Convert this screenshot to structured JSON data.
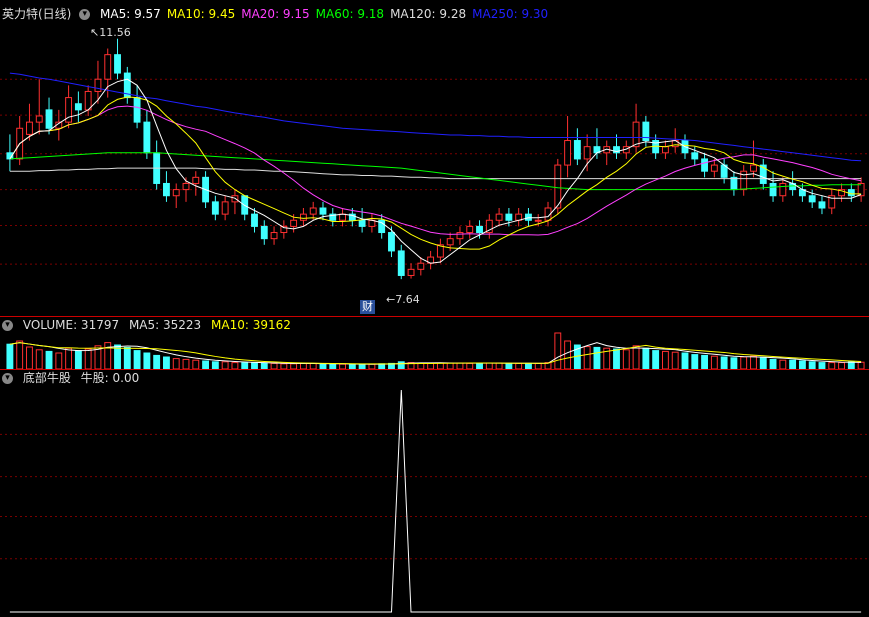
{
  "main": {
    "title": "英力特(日线)",
    "ma": [
      {
        "label": "MA5",
        "value": "9.57",
        "color": "#ffffff"
      },
      {
        "label": "MA10",
        "value": "9.45",
        "color": "#ffff00"
      },
      {
        "label": "MA20",
        "value": "9.15",
        "color": "#ff40ff"
      },
      {
        "label": "MA60",
        "value": "9.18",
        "color": "#00ff00"
      },
      {
        "label": "MA120",
        "value": "9.28",
        "color": "#dddddd"
      },
      {
        "label": "MA250",
        "value": "9.30",
        "color": "#2020ff"
      }
    ],
    "high_label": "11.56",
    "low_label": "7.64",
    "cai_badge": "财"
  },
  "volume": {
    "label": "VOLUME: 31797",
    "ma5": "MA5: 35223",
    "ma10": "MA10: 39162"
  },
  "indicator": {
    "title": "底部牛股",
    "line_label": "牛股: 0.00"
  },
  "colors": {
    "up": "#ff3030",
    "down": "#40ffff",
    "grid": "#7a0000",
    "border": "#c00000"
  },
  "chart_data": {
    "type": "candlestick",
    "price_range": [
      7.64,
      11.56
    ],
    "candles": [
      [
        9.7,
        10.0,
        9.4,
        9.6
      ],
      [
        9.6,
        10.3,
        9.5,
        10.1
      ],
      [
        10.0,
        10.5,
        9.9,
        10.2
      ],
      [
        10.2,
        10.9,
        10.0,
        10.3
      ],
      [
        10.4,
        10.6,
        10.0,
        10.1
      ],
      [
        10.1,
        10.4,
        9.9,
        10.2
      ],
      [
        10.2,
        10.8,
        10.1,
        10.6
      ],
      [
        10.5,
        10.7,
        10.2,
        10.4
      ],
      [
        10.4,
        10.8,
        10.3,
        10.7
      ],
      [
        10.7,
        11.2,
        10.5,
        10.9
      ],
      [
        10.9,
        11.4,
        10.6,
        11.3
      ],
      [
        11.3,
        11.56,
        10.9,
        11.0
      ],
      [
        11.0,
        11.1,
        10.5,
        10.6
      ],
      [
        10.6,
        10.8,
        10.1,
        10.2
      ],
      [
        10.2,
        10.4,
        9.6,
        9.7
      ],
      [
        9.7,
        9.9,
        9.1,
        9.2
      ],
      [
        9.2,
        9.4,
        8.9,
        9.0
      ],
      [
        9.0,
        9.2,
        8.8,
        9.1
      ],
      [
        9.1,
        9.3,
        8.9,
        9.2
      ],
      [
        9.2,
        9.4,
        9.0,
        9.3
      ],
      [
        9.3,
        9.4,
        8.8,
        8.9
      ],
      [
        8.9,
        9.0,
        8.6,
        8.7
      ],
      [
        8.7,
        9.0,
        8.6,
        8.9
      ],
      [
        8.9,
        9.1,
        8.7,
        9.0
      ],
      [
        9.0,
        9.0,
        8.6,
        8.7
      ],
      [
        8.7,
        8.8,
        8.4,
        8.5
      ],
      [
        8.5,
        8.6,
        8.2,
        8.3
      ],
      [
        8.3,
        8.5,
        8.2,
        8.4
      ],
      [
        8.4,
        8.6,
        8.3,
        8.5
      ],
      [
        8.5,
        8.7,
        8.4,
        8.6
      ],
      [
        8.6,
        8.8,
        8.5,
        8.7
      ],
      [
        8.7,
        8.9,
        8.6,
        8.8
      ],
      [
        8.8,
        8.9,
        8.6,
        8.7
      ],
      [
        8.7,
        8.8,
        8.5,
        8.6
      ],
      [
        8.6,
        8.8,
        8.5,
        8.7
      ],
      [
        8.7,
        8.8,
        8.5,
        8.6
      ],
      [
        8.6,
        8.8,
        8.4,
        8.5
      ],
      [
        8.5,
        8.7,
        8.4,
        8.6
      ],
      [
        8.6,
        8.7,
        8.3,
        8.4
      ],
      [
        8.4,
        8.5,
        8.0,
        8.1
      ],
      [
        8.1,
        8.2,
        7.64,
        7.7
      ],
      [
        7.7,
        7.9,
        7.65,
        7.8
      ],
      [
        7.8,
        8.0,
        7.7,
        7.9
      ],
      [
        7.9,
        8.1,
        7.8,
        8.0
      ],
      [
        8.0,
        8.3,
        7.9,
        8.2
      ],
      [
        8.2,
        8.4,
        8.1,
        8.3
      ],
      [
        8.3,
        8.5,
        8.2,
        8.4
      ],
      [
        8.4,
        8.6,
        8.3,
        8.5
      ],
      [
        8.5,
        8.6,
        8.3,
        8.4
      ],
      [
        8.4,
        8.7,
        8.3,
        8.6
      ],
      [
        8.6,
        8.8,
        8.5,
        8.7
      ],
      [
        8.7,
        8.8,
        8.5,
        8.6
      ],
      [
        8.6,
        8.8,
        8.5,
        8.7
      ],
      [
        8.7,
        8.8,
        8.5,
        8.6
      ],
      [
        8.6,
        8.7,
        8.5,
        8.6
      ],
      [
        8.6,
        8.9,
        8.5,
        8.8
      ],
      [
        8.8,
        9.6,
        8.7,
        9.5
      ],
      [
        9.5,
        10.3,
        9.3,
        9.9
      ],
      [
        9.9,
        10.1,
        9.5,
        9.6
      ],
      [
        9.6,
        10.0,
        9.4,
        9.8
      ],
      [
        9.8,
        10.1,
        9.6,
        9.7
      ],
      [
        9.7,
        9.9,
        9.5,
        9.8
      ],
      [
        9.8,
        10.0,
        9.6,
        9.7
      ],
      [
        9.7,
        9.9,
        9.6,
        9.8
      ],
      [
        9.8,
        10.5,
        9.7,
        10.2
      ],
      [
        10.2,
        10.3,
        9.8,
        9.9
      ],
      [
        9.9,
        10.0,
        9.6,
        9.7
      ],
      [
        9.7,
        9.9,
        9.6,
        9.8
      ],
      [
        9.8,
        10.1,
        9.7,
        9.9
      ],
      [
        9.9,
        10.0,
        9.6,
        9.7
      ],
      [
        9.7,
        9.8,
        9.5,
        9.6
      ],
      [
        9.6,
        9.7,
        9.3,
        9.4
      ],
      [
        9.4,
        9.6,
        9.3,
        9.5
      ],
      [
        9.5,
        9.6,
        9.2,
        9.3
      ],
      [
        9.3,
        9.4,
        9.0,
        9.1
      ],
      [
        9.1,
        9.5,
        9.0,
        9.4
      ],
      [
        9.4,
        9.9,
        9.3,
        9.5
      ],
      [
        9.5,
        9.6,
        9.1,
        9.2
      ],
      [
        9.2,
        9.4,
        8.9,
        9.0
      ],
      [
        9.0,
        9.3,
        8.9,
        9.2
      ],
      [
        9.2,
        9.4,
        9.0,
        9.1
      ],
      [
        9.1,
        9.2,
        8.9,
        9.0
      ],
      [
        9.0,
        9.1,
        8.8,
        8.9
      ],
      [
        8.9,
        9.0,
        8.7,
        8.8
      ],
      [
        8.8,
        9.1,
        8.7,
        9.0
      ],
      [
        9.0,
        9.2,
        8.9,
        9.1
      ],
      [
        9.1,
        9.2,
        8.9,
        9.0
      ],
      [
        9.0,
        9.3,
        8.9,
        9.2
      ]
    ],
    "volume": [
      62,
      70,
      55,
      48,
      44,
      40,
      52,
      46,
      50,
      58,
      66,
      60,
      54,
      46,
      40,
      34,
      30,
      26,
      24,
      22,
      20,
      18,
      18,
      16,
      16,
      15,
      14,
      14,
      13,
      13,
      14,
      14,
      13,
      12,
      12,
      12,
      12,
      12,
      13,
      14,
      18,
      16,
      15,
      14,
      15,
      15,
      15,
      14,
      14,
      15,
      15,
      14,
      14,
      14,
      14,
      16,
      90,
      70,
      60,
      56,
      54,
      52,
      50,
      48,
      58,
      52,
      46,
      44,
      42,
      40,
      36,
      34,
      32,
      30,
      28,
      30,
      32,
      28,
      24,
      22,
      22,
      20,
      18,
      16,
      16,
      16,
      18,
      17
    ],
    "indicator": [
      0,
      0,
      0,
      0,
      0,
      0,
      0,
      0,
      0,
      0,
      0,
      0,
      0,
      0,
      0,
      0,
      0,
      0,
      0,
      0,
      0,
      0,
      0,
      0,
      0,
      0,
      0,
      0,
      0,
      0,
      0,
      0,
      0,
      0,
      0,
      0,
      0,
      0,
      0,
      0,
      1,
      0,
      0,
      0,
      0,
      0,
      0,
      0,
      0,
      0,
      0,
      0,
      0,
      0,
      0,
      0,
      0,
      0,
      0,
      0,
      0,
      0,
      0,
      0,
      0,
      0,
      0,
      0,
      0,
      0,
      0,
      0,
      0,
      0,
      0,
      0,
      0,
      0,
      0,
      0,
      0,
      0,
      0,
      0,
      0,
      0,
      0,
      0
    ],
    "ma250": [
      11.0,
      10.98,
      10.95,
      10.92,
      10.9,
      10.87,
      10.84,
      10.81,
      10.78,
      10.75,
      10.72,
      10.69,
      10.66,
      10.63,
      10.6,
      10.58,
      10.55,
      10.52,
      10.49,
      10.46,
      10.44,
      10.41,
      10.38,
      10.35,
      10.33,
      10.3,
      10.28,
      10.25,
      10.22,
      10.2,
      10.18,
      10.16,
      10.14,
      10.12,
      10.1,
      10.09,
      10.08,
      10.07,
      10.06,
      10.05,
      10.04,
      10.03,
      10.02,
      10.01,
      10.0,
      9.99,
      9.99,
      9.98,
      9.98,
      9.97,
      9.97,
      9.96,
      9.96,
      9.95,
      9.95,
      9.95,
      9.95,
      9.95,
      9.95,
      9.95,
      9.95,
      9.95,
      9.95,
      9.95,
      9.95,
      9.95,
      9.94,
      9.93,
      9.92,
      9.91,
      9.9,
      9.88,
      9.86,
      9.84,
      9.82,
      9.8,
      9.78,
      9.76,
      9.74,
      9.72,
      9.7,
      9.68,
      9.66,
      9.64,
      9.62,
      9.6,
      9.58,
      9.57
    ],
    "ma120": [
      9.4,
      9.4,
      9.4,
      9.41,
      9.41,
      9.42,
      9.42,
      9.43,
      9.43,
      9.44,
      9.44,
      9.45,
      9.45,
      9.45,
      9.45,
      9.45,
      9.45,
      9.45,
      9.45,
      9.45,
      9.44,
      9.44,
      9.43,
      9.43,
      9.42,
      9.42,
      9.41,
      9.4,
      9.4,
      9.39,
      9.38,
      9.37,
      9.36,
      9.35,
      9.34,
      9.34,
      9.33,
      9.33,
      9.32,
      9.32,
      9.31,
      9.3,
      9.3,
      9.29,
      9.29,
      9.28,
      9.28,
      9.28,
      9.28,
      9.28,
      9.28,
      9.28,
      9.28,
      9.28,
      9.28,
      9.28,
      9.28,
      9.28,
      9.28,
      9.28,
      9.28,
      9.28,
      9.28,
      9.28,
      9.28,
      9.28,
      9.28,
      9.28,
      9.28,
      9.28,
      9.28,
      9.28,
      9.28,
      9.28,
      9.28,
      9.28,
      9.28,
      9.28,
      9.28,
      9.28,
      9.28,
      9.28,
      9.28,
      9.28,
      9.28,
      9.28,
      9.28,
      9.28
    ],
    "ma60": [
      9.6,
      9.61,
      9.62,
      9.63,
      9.64,
      9.65,
      9.66,
      9.67,
      9.68,
      9.69,
      9.7,
      9.7,
      9.7,
      9.7,
      9.7,
      9.7,
      9.69,
      9.68,
      9.67,
      9.66,
      9.65,
      9.64,
      9.63,
      9.62,
      9.61,
      9.6,
      9.59,
      9.58,
      9.57,
      9.56,
      9.55,
      9.54,
      9.53,
      9.52,
      9.51,
      9.5,
      9.49,
      9.48,
      9.47,
      9.46,
      9.45,
      9.43,
      9.41,
      9.39,
      9.37,
      9.35,
      9.33,
      9.31,
      9.29,
      9.27,
      9.25,
      9.23,
      9.21,
      9.19,
      9.17,
      9.15,
      9.13,
      9.12,
      9.11,
      9.1,
      9.1,
      9.1,
      9.1,
      9.1,
      9.1,
      9.1,
      9.1,
      9.1,
      9.1,
      9.1,
      9.1,
      9.1,
      9.1,
      9.1,
      9.1,
      9.11,
      9.12,
      9.13,
      9.14,
      9.15,
      9.16,
      9.16,
      9.17,
      9.17,
      9.18,
      9.18,
      9.18,
      9.18
    ]
  }
}
